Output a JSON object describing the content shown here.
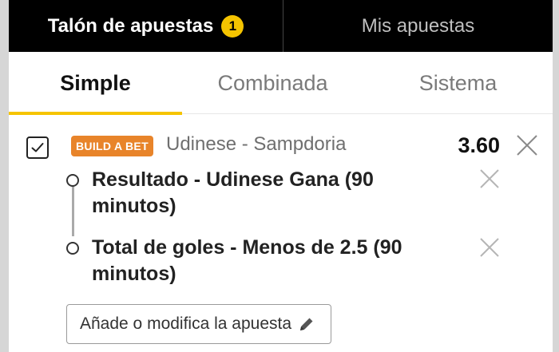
{
  "header": {
    "tabs": [
      {
        "label": "Talón de apuestas",
        "badge": "1",
        "active": true
      },
      {
        "label": "Mis apuestas",
        "active": false
      }
    ]
  },
  "bet_type_tabs": [
    {
      "label": "Simple",
      "active": true
    },
    {
      "label": "Combinada",
      "active": false
    },
    {
      "label": "Sistema",
      "active": false
    }
  ],
  "bet": {
    "checked": true,
    "badge": "BUILD A BET",
    "match": "Udinese - Sampdoria",
    "odds": "3.60",
    "legs": [
      {
        "text": "Resultado - Udinese Gana (90 minutos)"
      },
      {
        "text": "Total de goles - Menos de 2.5 (90 minutos)"
      }
    ],
    "edit_label": "Añade o modifica la apuesta"
  },
  "colors": {
    "accent_yellow": "#f5c400",
    "build_a_bet_orange": "#e8842a",
    "header_black": "#000000"
  },
  "icons": [
    "check-icon",
    "close-icon",
    "pencil-icon"
  ]
}
